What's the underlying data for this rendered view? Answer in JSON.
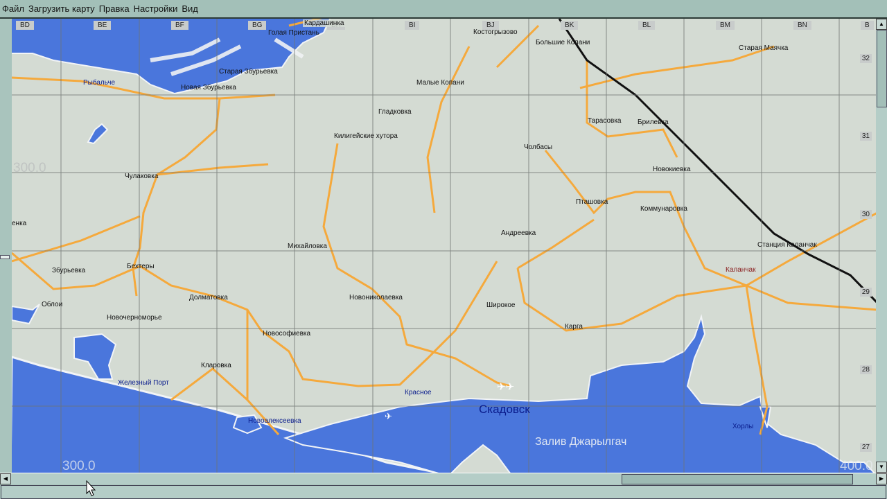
{
  "menu": [
    "Файл",
    "Загрузить карту",
    "Правка",
    "Настройки",
    "Вид"
  ],
  "columns": [
    "BD",
    "BE",
    "BF",
    "BG",
    "BH",
    "BI",
    "BJ",
    "BK",
    "BL",
    "BM",
    "BN",
    "B"
  ],
  "rows": [
    "32",
    "31",
    "30",
    "29",
    "28",
    "27"
  ],
  "scale_labels": {
    "left_mid": "300.0",
    "bottom_left": "300.0",
    "bottom_right": "400.0"
  },
  "towns": [
    "Кардашинка",
    "Голая Пристань",
    "Костогрызово",
    "Большие Копани",
    "Старая Маячка",
    "Рыбальче",
    "Старая Збурьевка",
    "Новая Збурьевка",
    "Малые Копани",
    "Гладковка",
    "Килигейские хутора",
    "Тарасовка",
    "Брилевка",
    "Чулаковка",
    "Чолбасы",
    "Новокиевка",
    "Пташовка",
    "Коммунаровка",
    "енка",
    "Михайловка",
    "Андреевка",
    "Станция Каланчак",
    "Збурьевка",
    "Бехтеры",
    "Каланчак",
    "Облои",
    "Долматовка",
    "Новониколаевка",
    "Широкое",
    "Новочерноморье",
    "Карга",
    "Новософиевка",
    "Кларовка",
    "Железный Порт",
    "Красное",
    "Скадовск",
    "Новоалексеевка",
    "Хорлы",
    "Залив Джарылгач"
  ],
  "colors": {
    "land": "#d4dbd3",
    "water": "#4a76dc",
    "road": "#f5a93c",
    "rail": "#111111",
    "grid": "#6f7472"
  }
}
